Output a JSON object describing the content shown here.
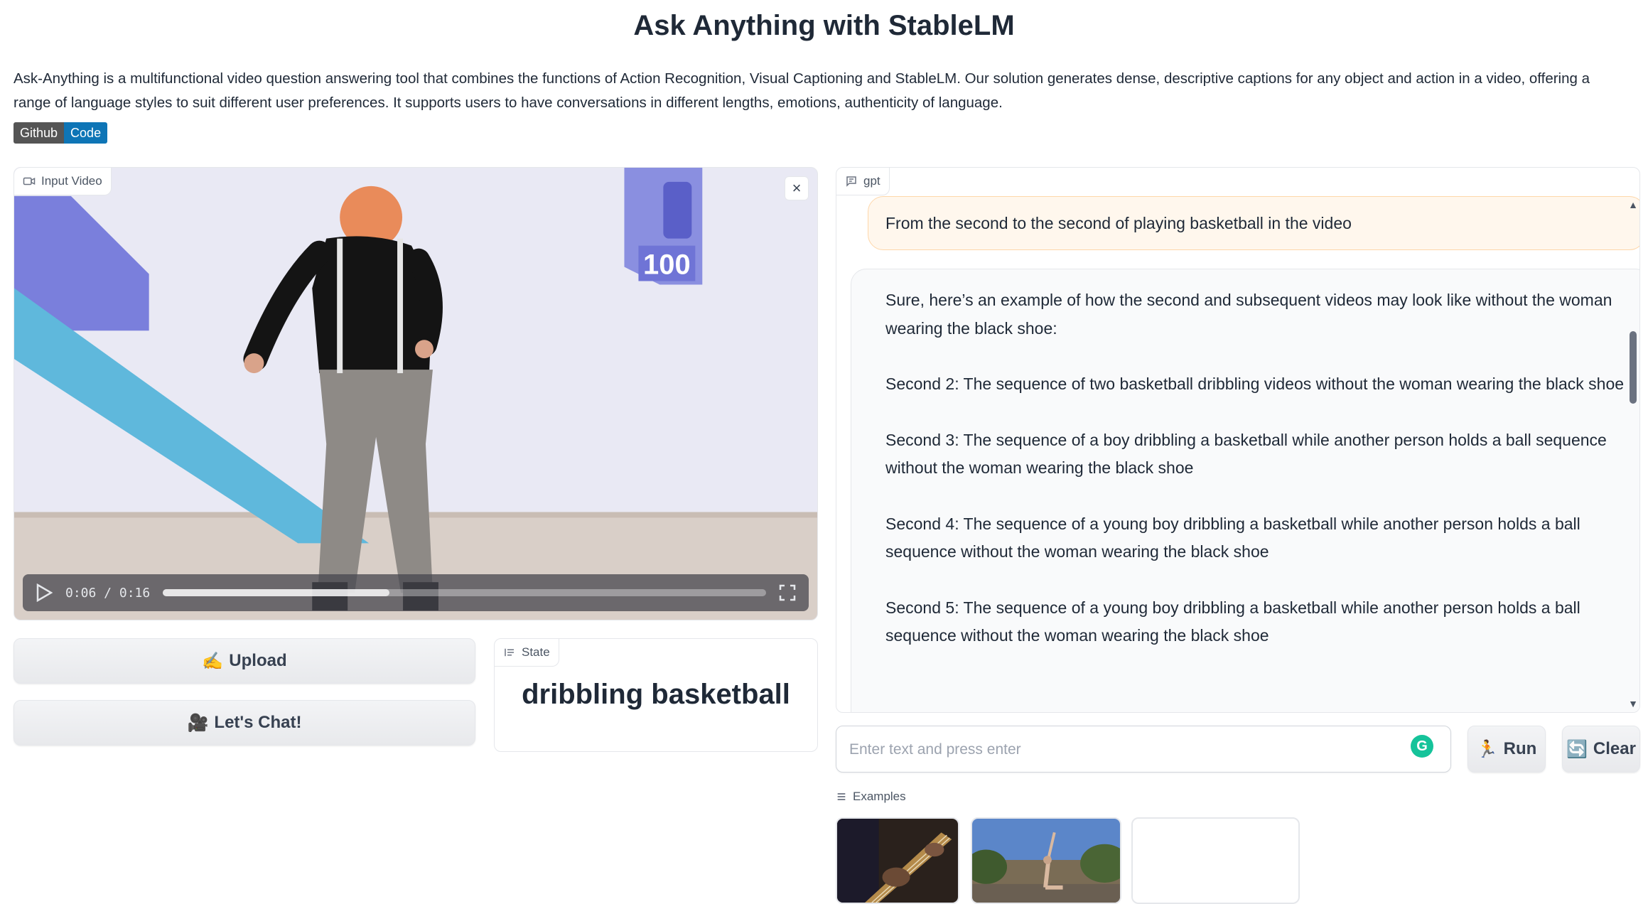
{
  "page": {
    "title": "Ask Anything with StableLM",
    "description": "Ask-Anything is a multifunctional video question answering tool that combines the functions of Action Recognition, Visual Captioning and StableLM. Our solution generates dense, descriptive captions for any object and action in a video, offering a range of language styles to suit different user preferences. It supports users to have conversations in different lengths, emotions, authenticity of language.",
    "badge": {
      "left": "Github",
      "right": "Code"
    }
  },
  "video": {
    "label": "Input Video",
    "time": "0:06 / 0:16",
    "progress": 0.375,
    "jersey_number": "100"
  },
  "buttons": {
    "upload_icon": "✍️",
    "upload": "Upload",
    "chat_icon": "🎥",
    "chat": "Let's Chat!",
    "run_icon": "🏃",
    "run": "Run",
    "clear_icon": "🔄",
    "clear": "Clear"
  },
  "state": {
    "label": "State",
    "value": "dribbling basketball"
  },
  "chat": {
    "label": "gpt",
    "user_message": "From the second to the second of playing basketball in the video",
    "bot_message": [
      "Sure, here’s an example of how the second and subsequent videos may look like without the woman wearing the black shoe:",
      "Second 2: The sequence of two basketball dribbling videos without the woman wearing the black shoe",
      "Second 3: The sequence of a boy dribbling a basketball while another person holds a ball sequence without the woman wearing the black shoe",
      "Second 4: The sequence of a young boy dribbling a basketball while another person holds a ball sequence without the woman wearing the black shoe",
      "Second 5: The sequence of a young boy dribbling a basketball while another person holds a ball sequence without the woman wearing the black shoe"
    ]
  },
  "input": {
    "placeholder": "Enter text and press enter",
    "grammarly": "G"
  },
  "examples": {
    "label": "Examples"
  },
  "colors": {
    "accent_badge": "#0e75b6",
    "user_bubble": "#fff7ed",
    "user_border": "#fed7aa"
  }
}
